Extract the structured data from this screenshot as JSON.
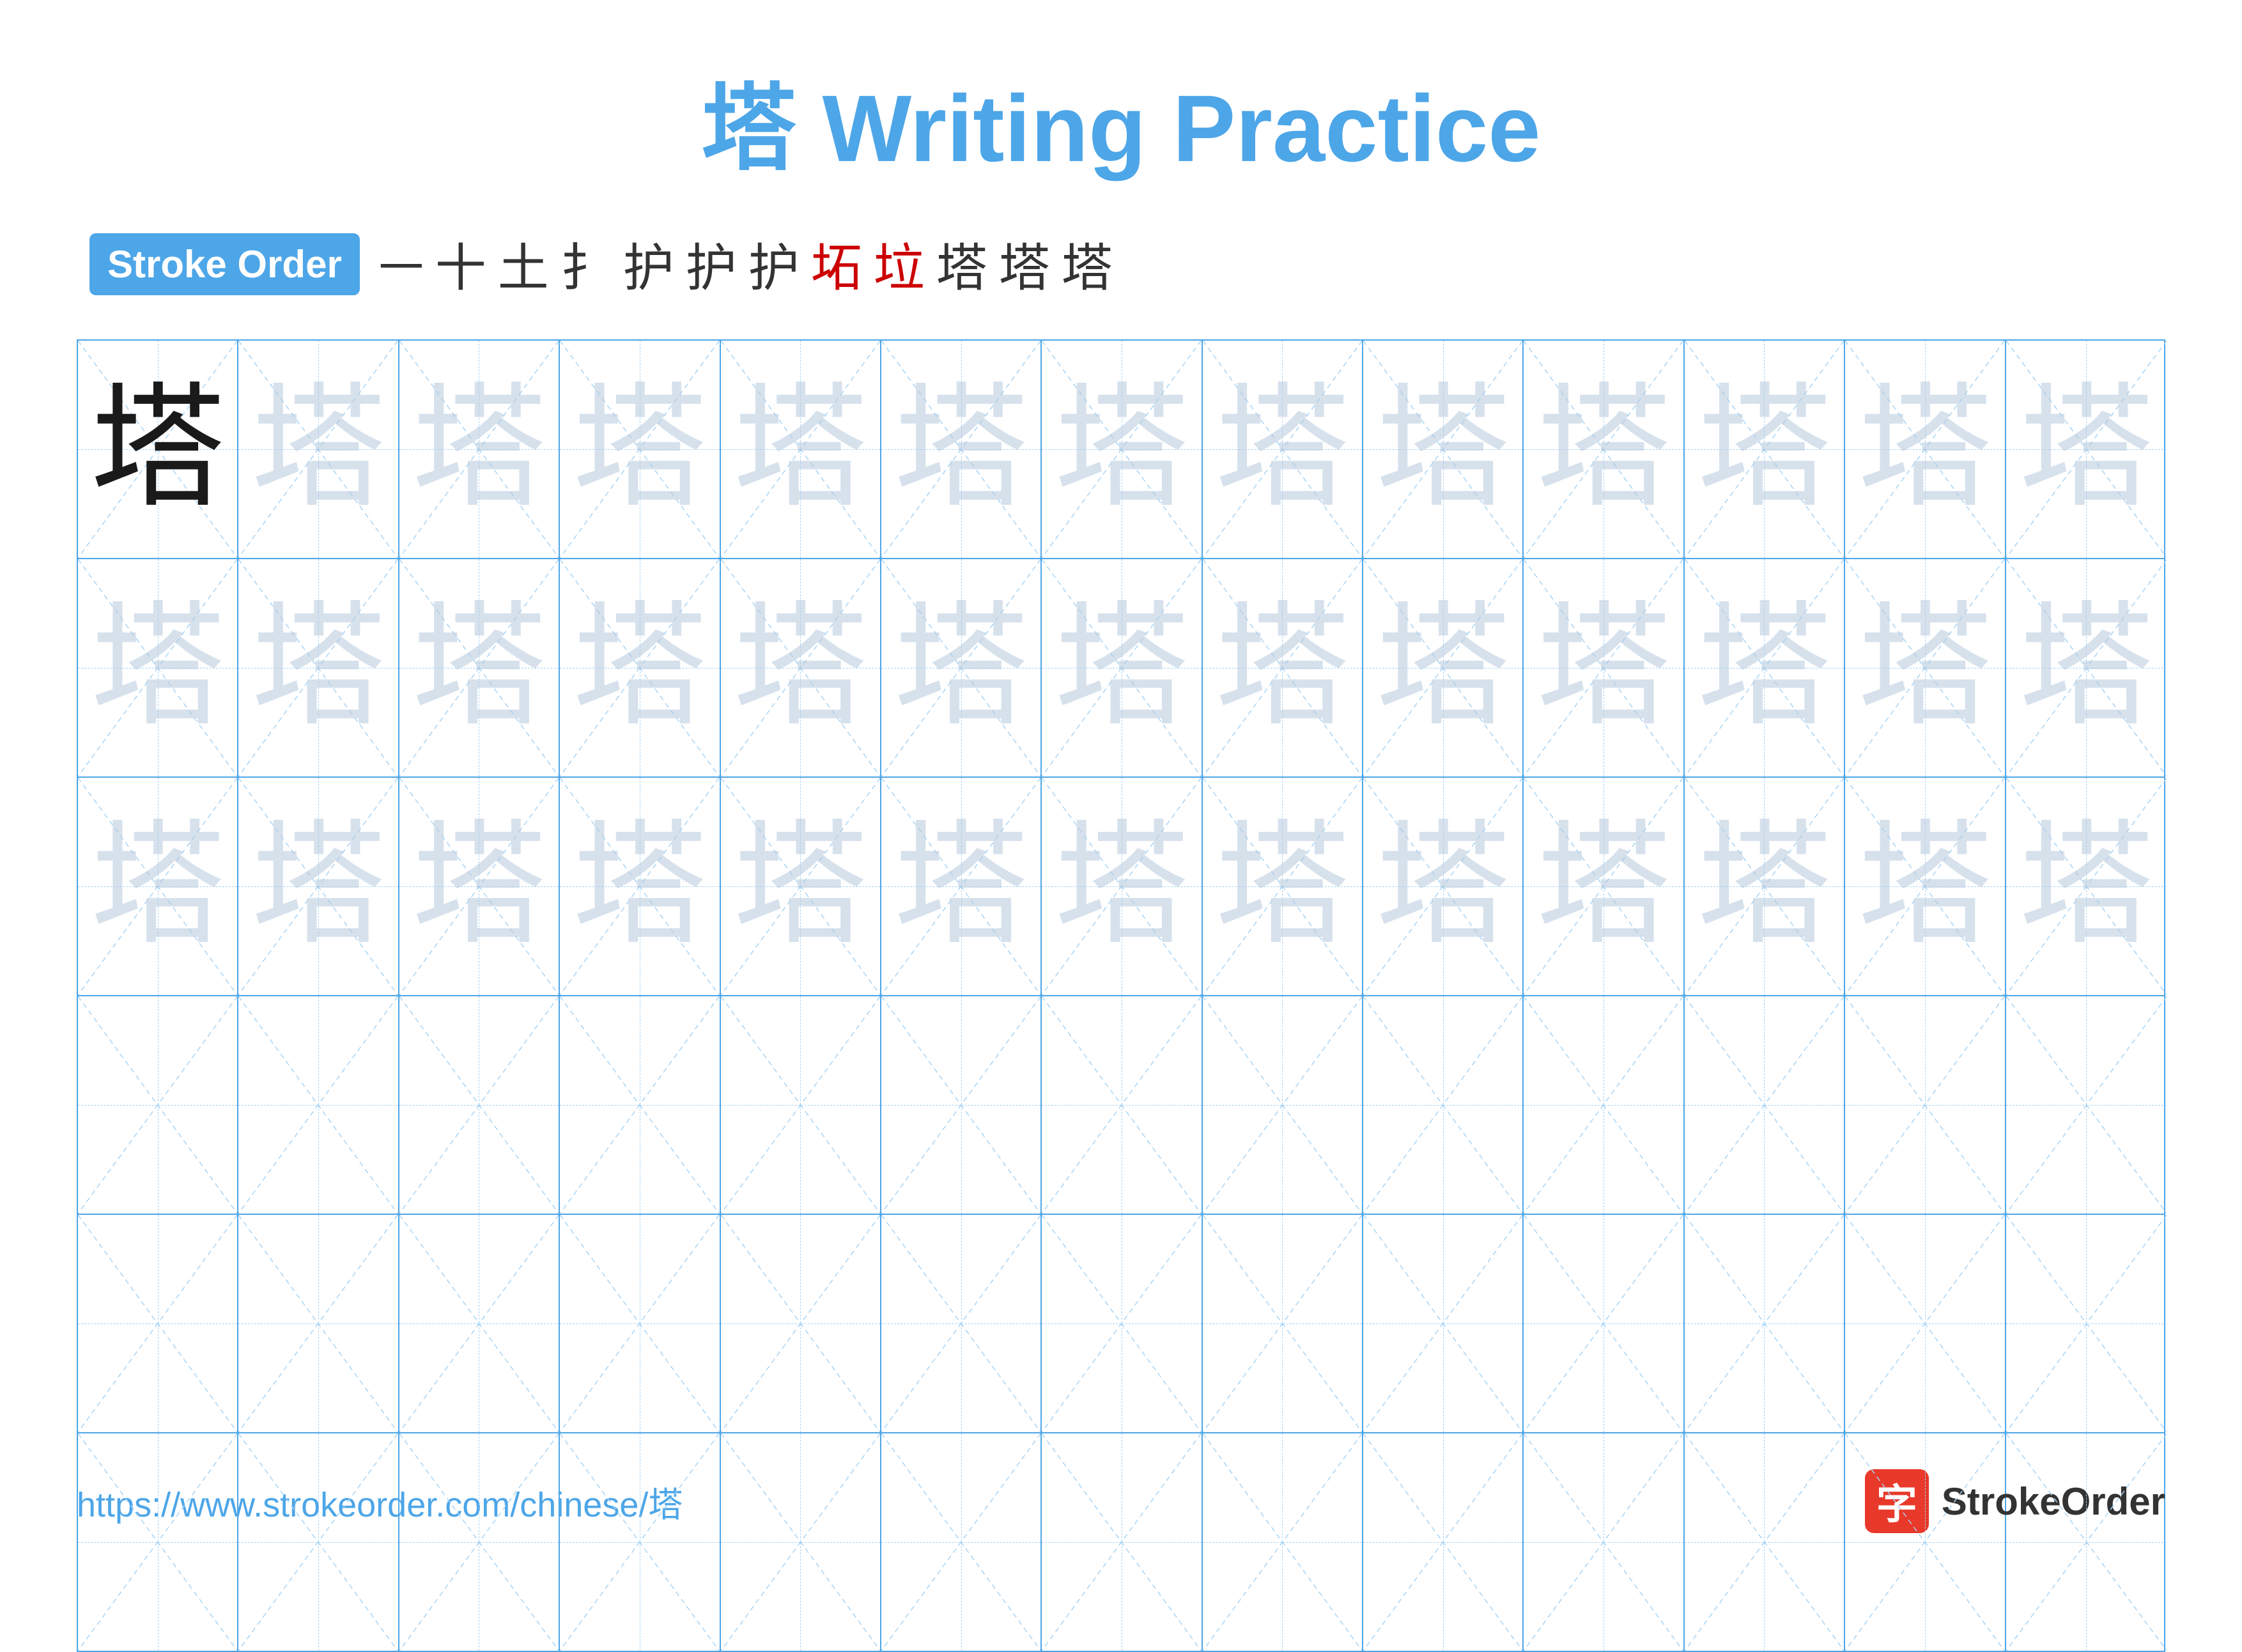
{
  "title": {
    "char": "塔",
    "text": "Writing Practice"
  },
  "strokeOrder": {
    "badge": "Stroke Order",
    "steps": [
      "一",
      "十",
      "土",
      "扌",
      "扗",
      "扞",
      "扡",
      "坧",
      "垃",
      "塔",
      "塔",
      "塔"
    ]
  },
  "grid": {
    "rows": 6,
    "cols": 13,
    "char": "塔",
    "row1_style": [
      "black",
      "light",
      "light",
      "light",
      "light",
      "light",
      "light",
      "light",
      "light",
      "light",
      "light",
      "light",
      "light"
    ],
    "row2_style": [
      "light",
      "light",
      "light",
      "light",
      "light",
      "light",
      "light",
      "light",
      "light",
      "light",
      "light",
      "light",
      "light"
    ],
    "row3_style": [
      "light",
      "light",
      "light",
      "light",
      "light",
      "light",
      "light",
      "light",
      "light",
      "light",
      "light",
      "light",
      "light"
    ],
    "row4_style": [
      "empty",
      "empty",
      "empty",
      "empty",
      "empty",
      "empty",
      "empty",
      "empty",
      "empty",
      "empty",
      "empty",
      "empty",
      "empty"
    ],
    "row5_style": [
      "empty",
      "empty",
      "empty",
      "empty",
      "empty",
      "empty",
      "empty",
      "empty",
      "empty",
      "empty",
      "empty",
      "empty",
      "empty"
    ],
    "row6_style": [
      "empty",
      "empty",
      "empty",
      "empty",
      "empty",
      "empty",
      "empty",
      "empty",
      "empty",
      "empty",
      "empty",
      "empty",
      "empty"
    ]
  },
  "footer": {
    "url": "https://www.strokeorder.com/chinese/塔",
    "brand": "StrokeOrder",
    "icon_char": "字"
  }
}
